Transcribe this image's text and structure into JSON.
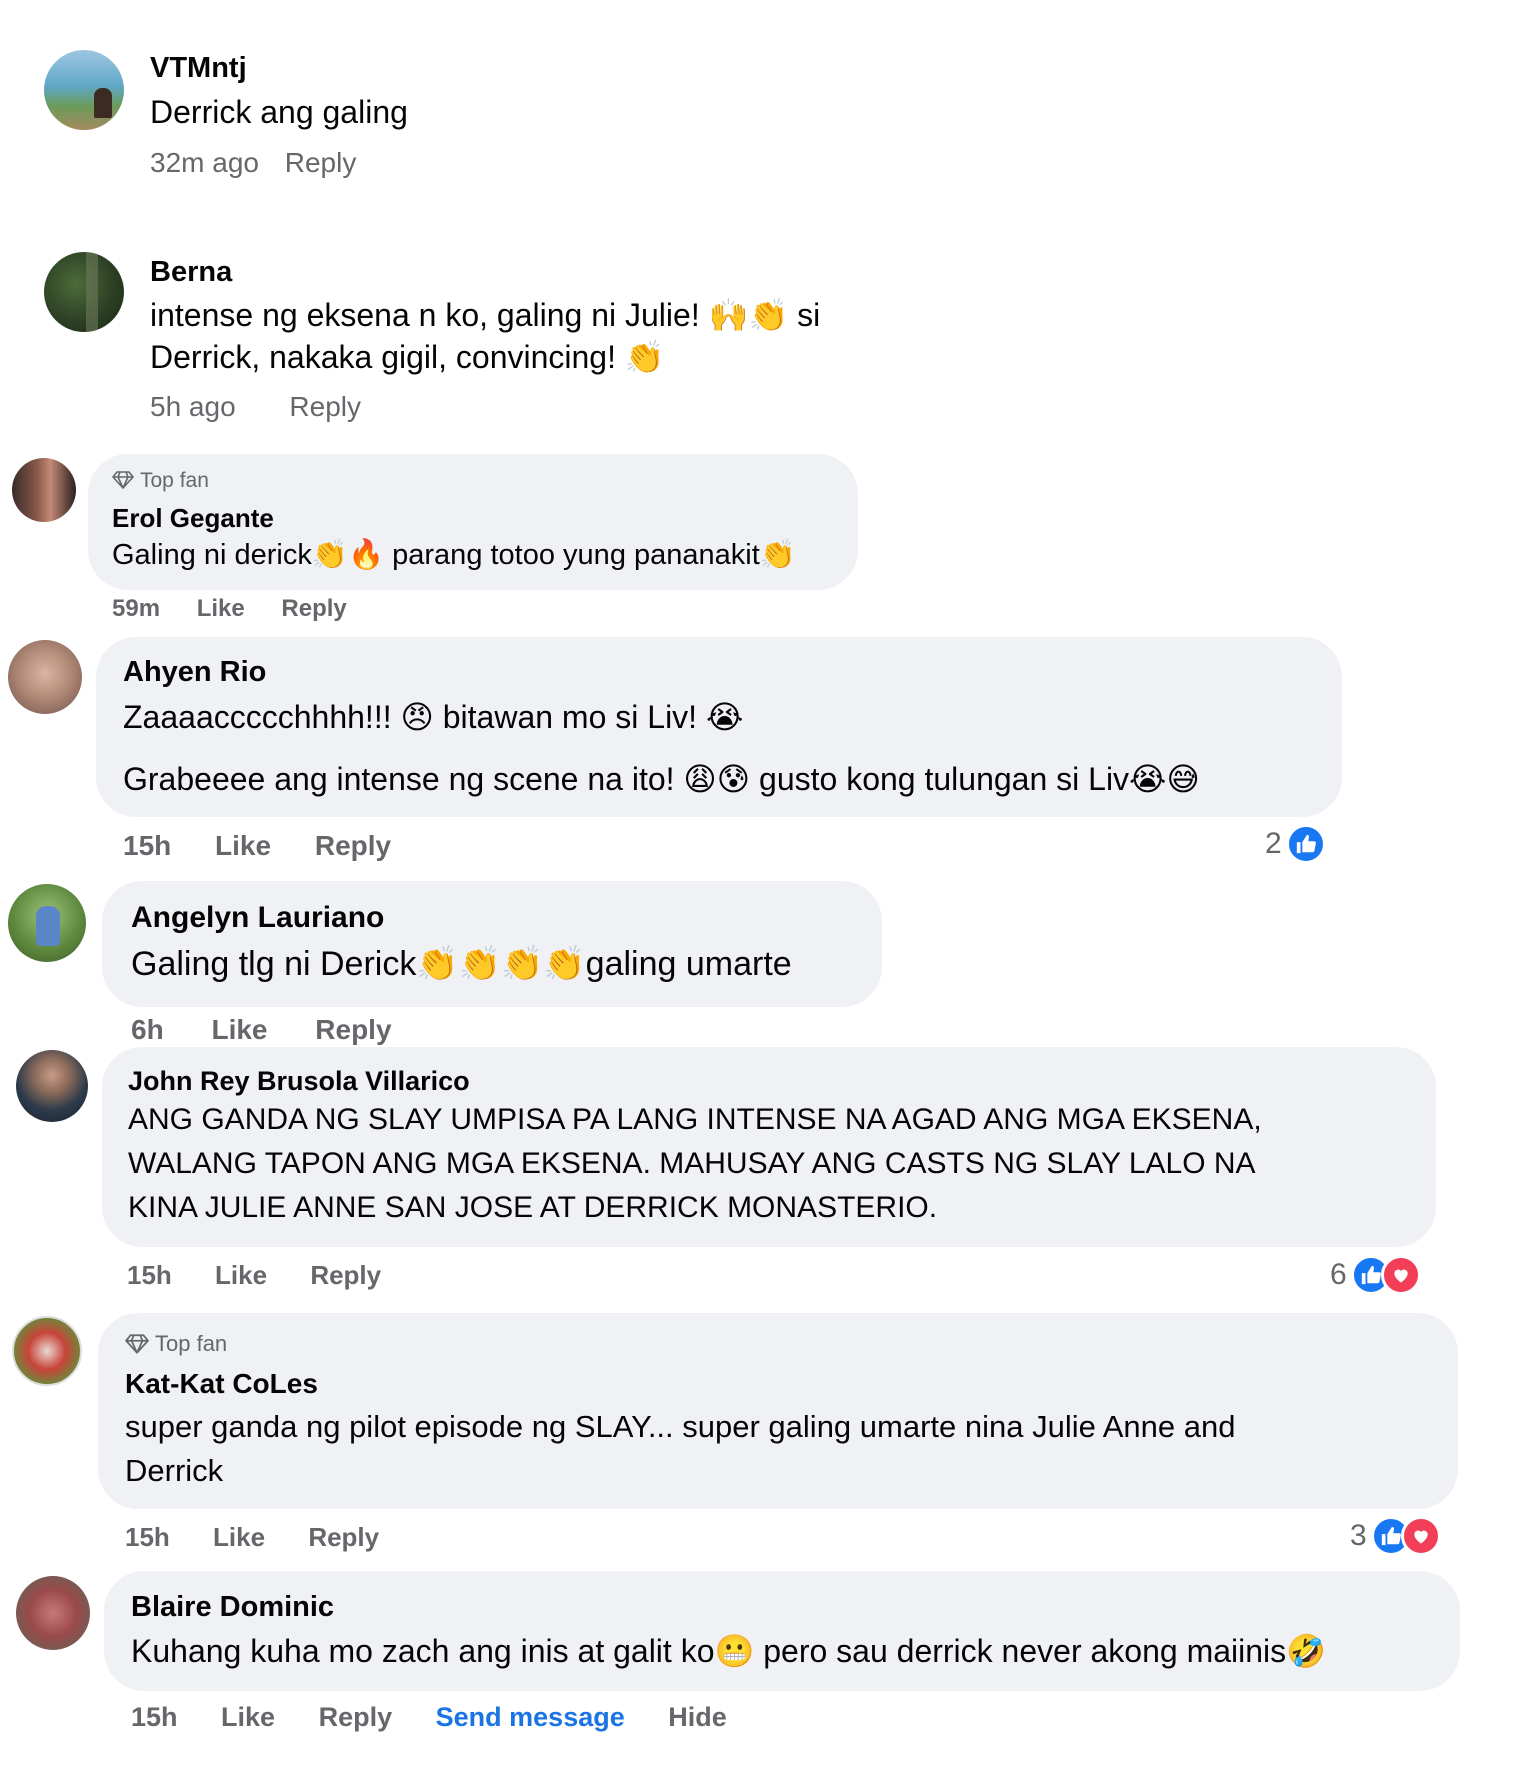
{
  "comments": [
    {
      "name": "VTMntj",
      "lines": [
        "Derrick ang galing"
      ],
      "time": "32m ago",
      "reply": "Reply"
    },
    {
      "name": "Berna",
      "lines": [
        "intense ng eksena n ko, galing ni Julie! 🙌👏 si",
        "Derrick, nakaka gigil, convincing! 👏"
      ],
      "time": "5h ago",
      "reply": "Reply"
    },
    {
      "badge": "Top fan",
      "name": "Erol Gegante",
      "lines": [
        "Galing ni derick👏🔥 parang totoo yung pananakit👏"
      ],
      "time": "59m",
      "like": "Like",
      "reply": "Reply"
    },
    {
      "name": "Ahyen Rio",
      "lines": [
        "Zaaaaccccchhhh!!! 😠 bitawan mo si Liv! 😭",
        "Grabeeee ang intense ng scene na ito! 😩😰 gusto kong tulungan si Liv😭😅"
      ],
      "time": "15h",
      "like": "Like",
      "reply": "Reply",
      "reaction_count": "2"
    },
    {
      "name": "Angelyn Lauriano",
      "lines": [
        "Galing tlg ni Derick👏👏👏👏galing umarte"
      ],
      "time": "6h",
      "like": "Like",
      "reply": "Reply"
    },
    {
      "name": "John Rey Brusola Villarico",
      "lines": [
        "ANG GANDA NG SLAY UMPISA PA LANG INTENSE NA AGAD ANG MGA EKSENA,",
        "WALANG TAPON ANG MGA EKSENA. MAHUSAY ANG CASTS NG SLAY LALO NA",
        "KINA JULIE ANNE SAN JOSE AT DERRICK MONASTERIO."
      ],
      "time": "15h",
      "like": "Like",
      "reply": "Reply",
      "reaction_count": "6"
    },
    {
      "badge": "Top fan",
      "name": "Kat-Kat CoLes",
      "lines": [
        "super ganda ng pilot episode ng SLAY... super galing umarte nina Julie Anne and",
        "Derrick"
      ],
      "time": "15h",
      "like": "Like",
      "reply": "Reply",
      "reaction_count": "3"
    },
    {
      "name": "Blaire Dominic",
      "lines": [
        "Kuhang kuha mo zach ang inis at galit ko😬 pero sau derrick never akong maiinis🤣"
      ],
      "time": "15h",
      "like": "Like",
      "reply": "Reply",
      "send_message": "Send message",
      "hide": "Hide"
    }
  ],
  "colors": {
    "bubble": "#eff1f5",
    "meta": "#65676b",
    "like_blue": "#1877f2",
    "love_red": "#f33e58",
    "link_blue": "#1b74e4"
  },
  "icons": [
    "diamond-icon",
    "like-reaction-icon",
    "love-reaction-icon"
  ]
}
